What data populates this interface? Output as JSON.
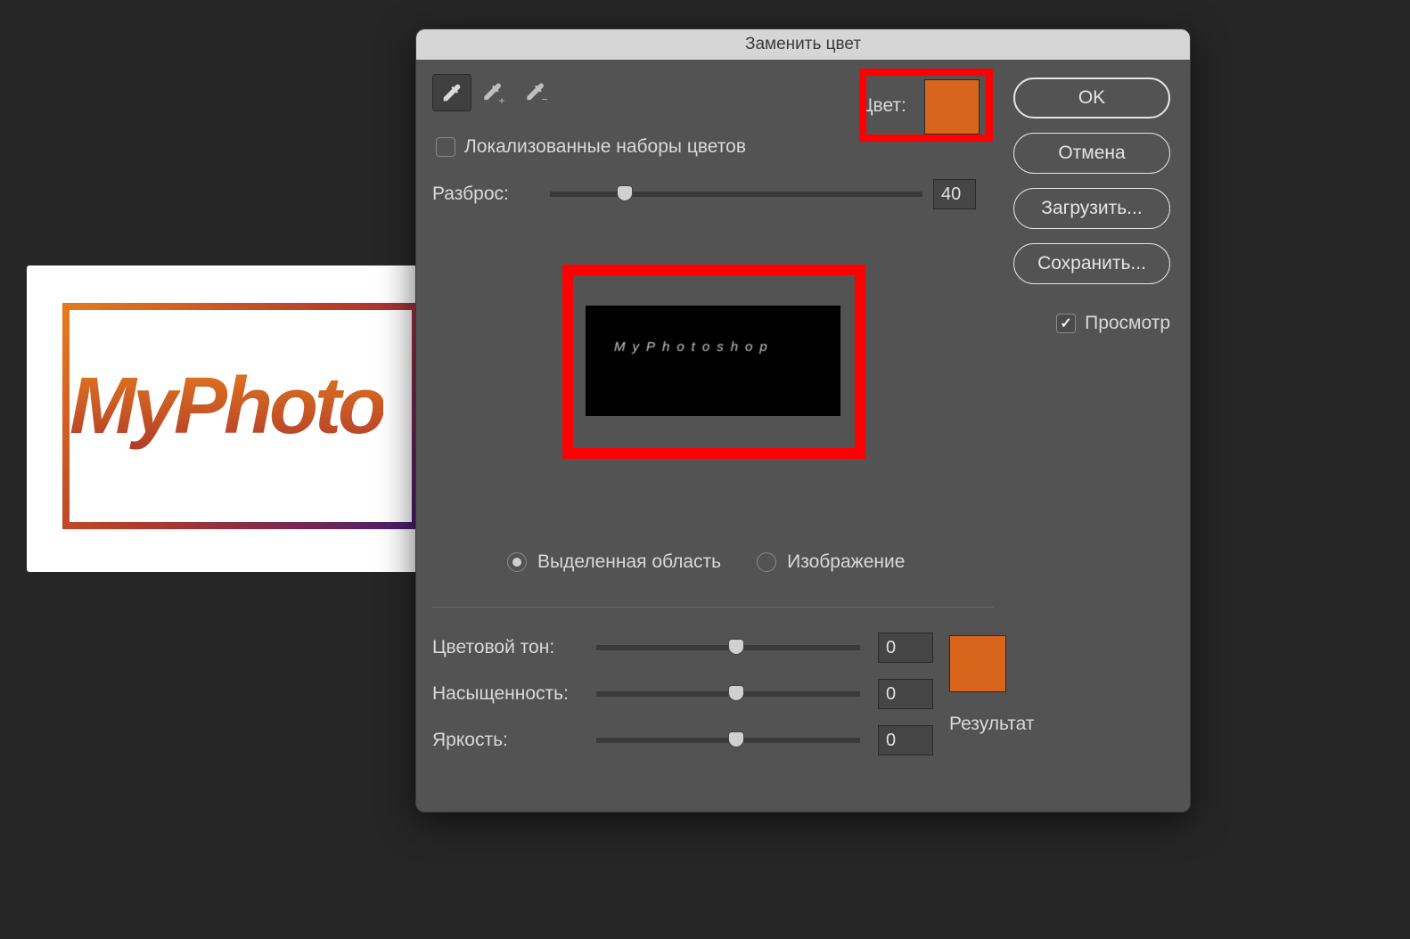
{
  "dialog_title": "Заменить цвет",
  "color_label": "Цвет:",
  "source_color": "#d8651b",
  "localized_checkbox_label": "Локализованные наборы цветов",
  "localized_checked": false,
  "fuzziness_label": "Разброс:",
  "fuzziness_value": "40",
  "fuzziness_percent": 18,
  "preview_mask_text": "MyPhotoshop",
  "view_mode": {
    "selection": "Выделенная область",
    "image": "Изображение",
    "selected": "selection"
  },
  "hsl": {
    "hue_label": "Цветовой тон:",
    "hue_value": "0",
    "sat_label": "Насыщенность:",
    "sat_value": "0",
    "lig_label": "Яркость:",
    "lig_value": "0"
  },
  "result_color": "#d8651b",
  "result_label": "Результат",
  "buttons": {
    "ok": "OK",
    "cancel": "Отмена",
    "load": "Загрузить...",
    "save": "Сохранить..."
  },
  "preview_checkbox_label": "Просмотр",
  "preview_checked": true,
  "canvas_logo_text": "MyPhoto"
}
